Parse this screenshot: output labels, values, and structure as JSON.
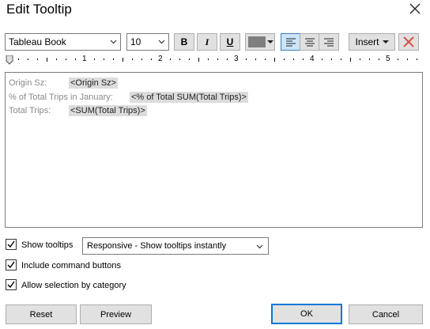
{
  "window": {
    "title": "Edit Tooltip",
    "close_icon": "close-icon"
  },
  "toolbar": {
    "font_family": "Tableau Book",
    "font_size": "10",
    "bold_label": "B",
    "italic_label": "I",
    "underline_label": "U",
    "font_color": "#7f7f7f",
    "insert_label": "Insert",
    "clear_icon": "red-x-icon",
    "accent": "#d9534f"
  },
  "ruler": {
    "labels": [
      "1",
      "2",
      "3",
      "4",
      "5"
    ]
  },
  "editor": {
    "rows": [
      {
        "label": "Origin Sz:",
        "field": "<Origin Sz>"
      },
      {
        "label": "% of Total Trips in January:",
        "field": "<% of Total SUM(Total Trips)>"
      },
      {
        "label": "Total Trips:",
        "field": "<SUM(Total Trips)>"
      }
    ]
  },
  "options": {
    "show_tooltips": {
      "label": "Show tooltips",
      "checked": true
    },
    "tooltip_mode": "Responsive - Show tooltips instantly",
    "include_buttons": {
      "label": "Include command buttons",
      "checked": true
    },
    "allow_selection": {
      "label": "Allow selection by category",
      "checked": true
    }
  },
  "buttons": {
    "reset": "Reset",
    "preview": "Preview",
    "ok": "OK",
    "cancel": "Cancel"
  }
}
